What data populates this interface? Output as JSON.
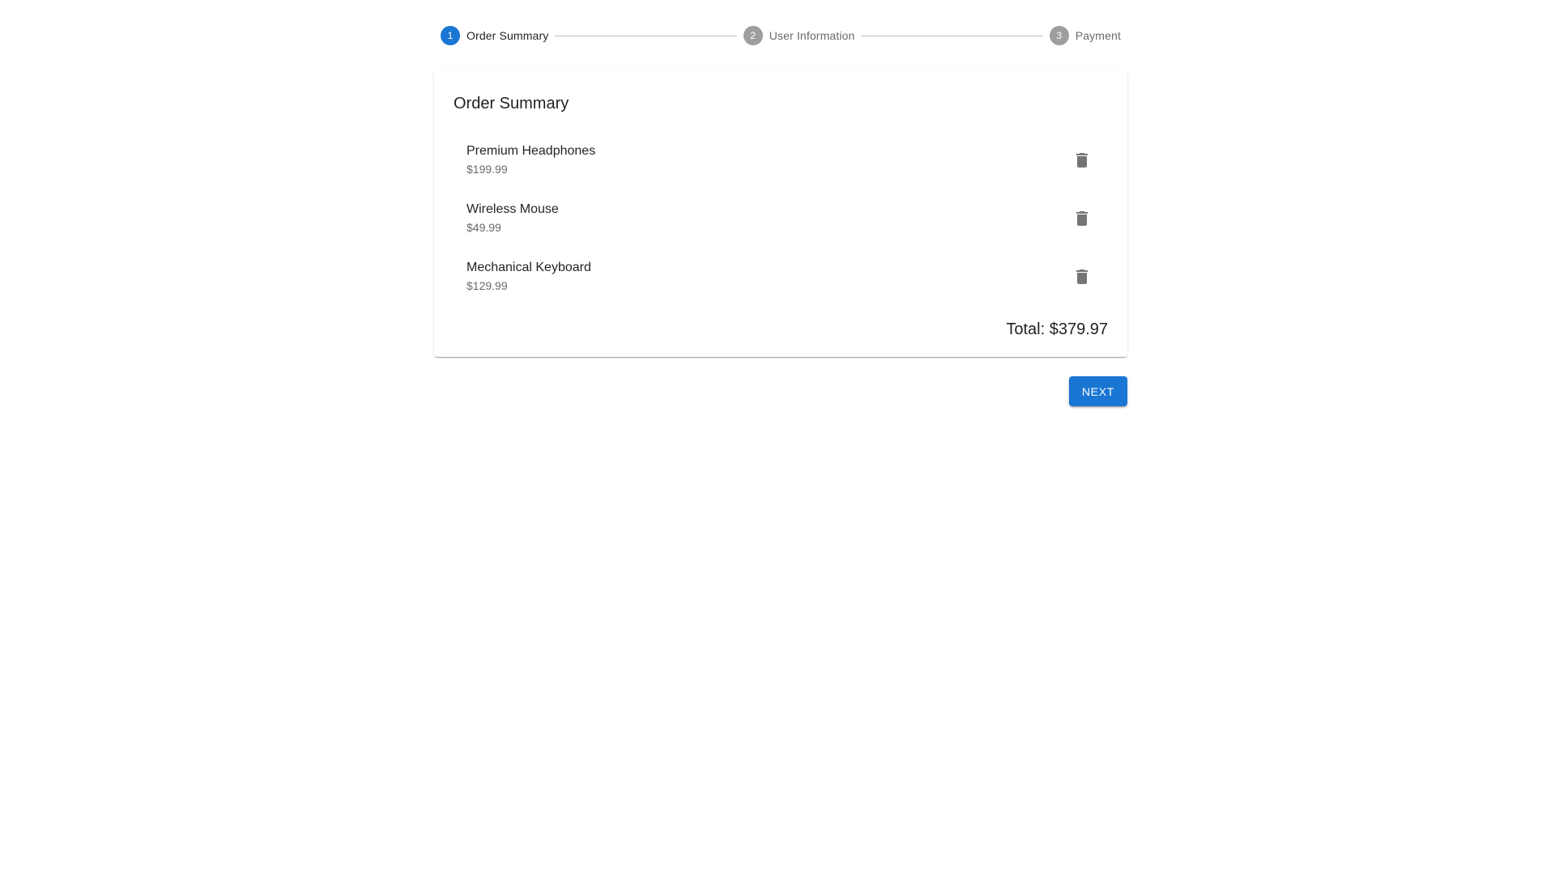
{
  "stepper": {
    "steps": [
      {
        "number": "1",
        "label": "Order Summary",
        "active": true
      },
      {
        "number": "2",
        "label": "User Information",
        "active": false
      },
      {
        "number": "3",
        "label": "Payment",
        "active": false
      }
    ]
  },
  "order": {
    "title": "Order Summary",
    "items": [
      {
        "name": "Premium Headphones",
        "price": "$199.99"
      },
      {
        "name": "Wireless Mouse",
        "price": "$49.99"
      },
      {
        "name": "Mechanical Keyboard",
        "price": "$129.99"
      }
    ],
    "total": "Total: $379.97"
  },
  "actions": {
    "next_label": "NEXT"
  },
  "icons": {
    "delete": "delete-icon"
  },
  "colors": {
    "primary": "#1976d2",
    "inactive_step": "#9e9e9e",
    "icon": "#757575"
  }
}
